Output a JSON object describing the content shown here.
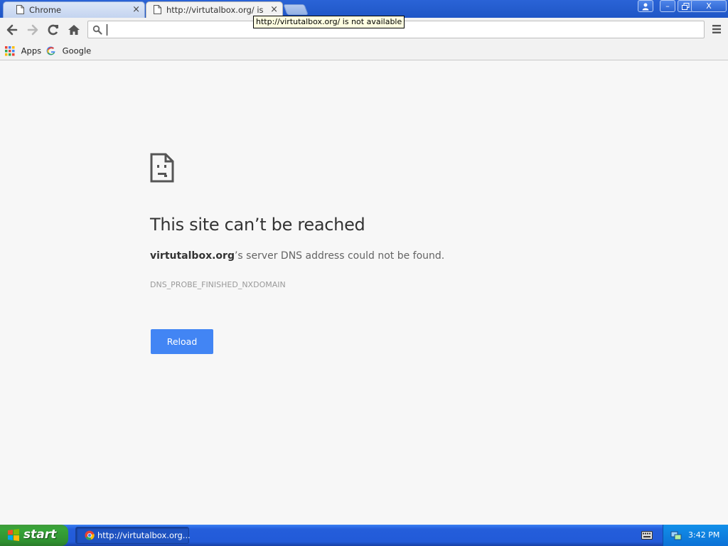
{
  "browser": {
    "tabs": [
      {
        "title": "Chrome",
        "close": "×"
      },
      {
        "title": "http://virtutalbox.org/ is not available",
        "close": "×"
      }
    ],
    "window_buttons": {
      "minimize": "–",
      "close": "X"
    },
    "omnibox": {
      "value": "",
      "placeholder": ""
    },
    "tooltip": "http://virtutalbox.org/ is not available",
    "bookmarks": [
      {
        "label": "Apps",
        "icon": "apps-grid-icon"
      },
      {
        "label": "Google",
        "icon": "google-g-icon"
      }
    ]
  },
  "error_page": {
    "icon": "sad-page-icon",
    "heading": "This site can’t be reached",
    "domain": "virtutalbox.org",
    "description_rest": "’s server DNS address could not be found.",
    "error_code": "DNS_PROBE_FINISHED_NXDOMAIN",
    "reload_label": "Reload"
  },
  "taskbar": {
    "start_label": "start",
    "task_item_label": "http://virtutalbox.org...",
    "clock": "3:42 PM"
  },
  "colors": {
    "xp_blue": "#245edb",
    "start_green": "#37a538",
    "reload_blue": "#4285f4",
    "page_bg": "#f7f7f7"
  }
}
